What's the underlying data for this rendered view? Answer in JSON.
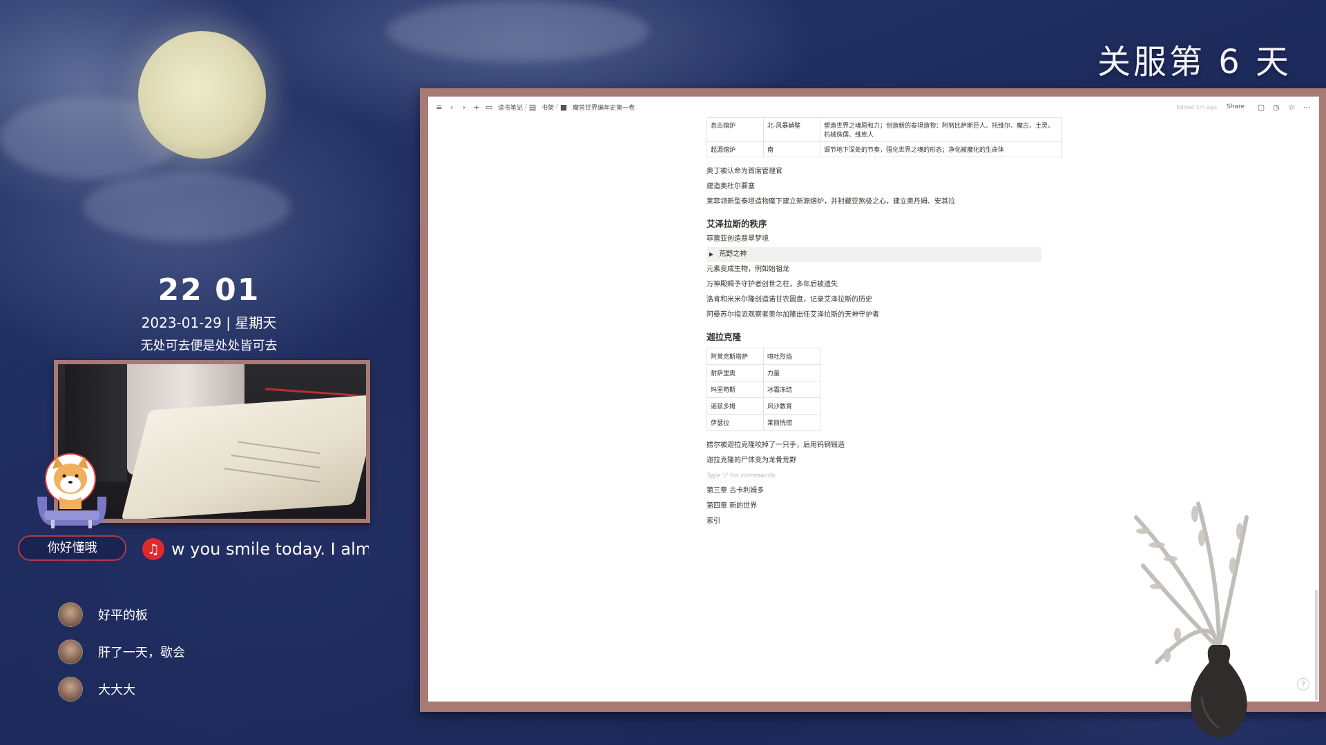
{
  "stream": {
    "title": "关服第 6 天"
  },
  "clock": {
    "time": "22 01",
    "date": "2023-01-29 | 星期天",
    "motto": "无处可去便是处处皆可去"
  },
  "streamer": {
    "name": "你好懂哦"
  },
  "music": {
    "lyric": "w you smile today. I almost"
  },
  "chat": [
    {
      "msg": "好平的板"
    },
    {
      "msg": "肝了一天，歇会"
    },
    {
      "msg": "大大大"
    }
  ],
  "notion": {
    "breadcrumb": [
      "读书笔记",
      "书架",
      "魔兽世界编年史第一卷"
    ],
    "edited": "Edited 1m ago",
    "share": "Share",
    "top_table": [
      [
        "息击熔炉",
        "北-风暴峭壁",
        "塑造世界之魂原和力；创造新的泰坦造物：阿努比萨斯巨人、托维尔、魔古、土灵、机械侏儒、维库人"
      ],
      [
        "起源熔炉",
        "南",
        "调节地下深处的节奏，强化世界之魂的形态；净化被魔化的生命体"
      ]
    ],
    "paragraphs_a": [
      "奥丁被认命为首席管理官",
      "建造奥杜尔要塞",
      "莱菲领新型泰坦造物麾下建立新源熔炉，并封藏亚煞极之心，建立奥丹姆、安其拉"
    ],
    "heading1": "艾泽拉斯的秩序",
    "para_after_h1": "菲蕾亚创造翡翠梦境",
    "toggle": "荒野之神",
    "paragraphs_b": [
      "元素变成生物，例如始祖龙",
      "万神殿赐予守护者创世之柱，多年后被遗失",
      "洛肯和米米尔隆创造诺甘农圆盘，记录艾泽拉斯的历史",
      "阿曼苏尔指派观察者奥尔加隆出任艾泽拉斯的天神守护者"
    ],
    "heading2": "迦拉克隆",
    "small_table": [
      [
        "阿莱克斯塔萨",
        "喷吐烈焰"
      ],
      [
        "耐萨里奥",
        "力量"
      ],
      [
        "玛里苟斯",
        "冰霜冻结"
      ],
      [
        "诺兹多姆",
        "风沙教育"
      ],
      [
        "伊瑟拉",
        "莱丽恍惚"
      ]
    ],
    "paragraphs_c": [
      "掳尔被迦拉克隆咬掉了一只手，后用钨钢锻造",
      "迦拉克隆的尸体变为龙骨荒野"
    ],
    "placeholder": "Type '/' for commands",
    "paragraphs_d": [
      "第三章 古卡利姆多",
      "第四章 新的世界",
      "索引"
    ],
    "help": "?"
  }
}
